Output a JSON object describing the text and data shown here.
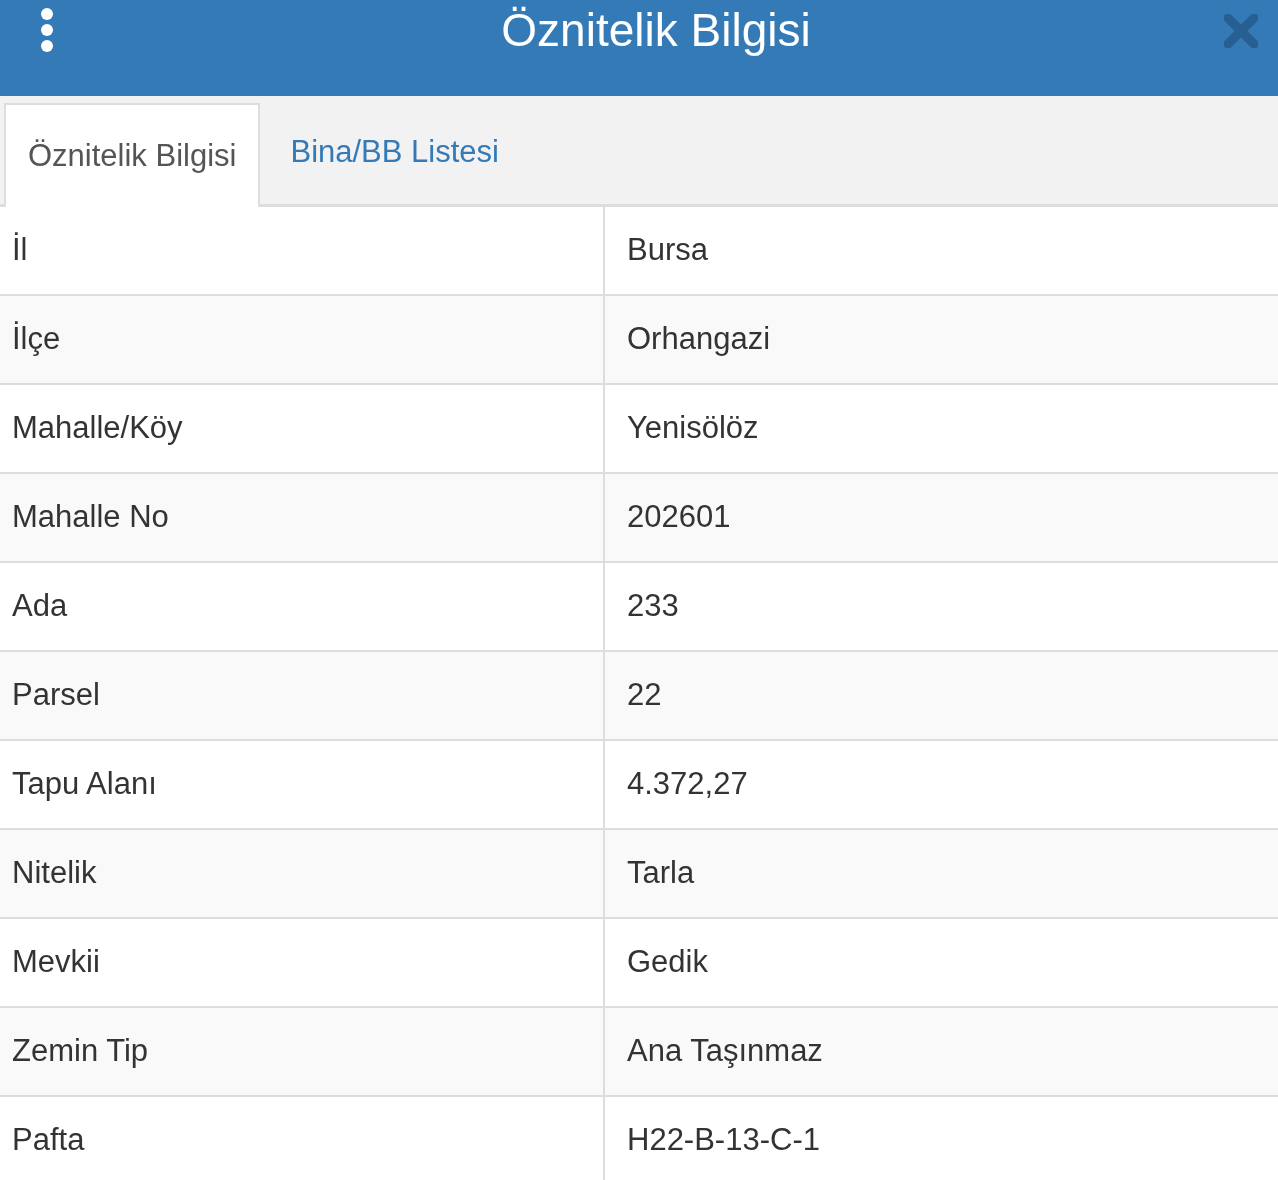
{
  "header": {
    "title": "Öznitelik Bilgisi"
  },
  "tabs": [
    {
      "label": "Öznitelik Bilgisi",
      "selected": true
    },
    {
      "label": "Bina/BB Listesi",
      "selected": false
    }
  ],
  "rows": [
    {
      "label": "İl",
      "value": "Bursa"
    },
    {
      "label": "İlçe",
      "value": "Orhangazi"
    },
    {
      "label": "Mahalle/Köy",
      "value": "Yenisölöz"
    },
    {
      "label": "Mahalle No",
      "value": "202601"
    },
    {
      "label": "Ada",
      "value": "233"
    },
    {
      "label": "Parsel",
      "value": "22"
    },
    {
      "label": "Tapu Alanı",
      "value": "4.372,27"
    },
    {
      "label": "Nitelik",
      "value": "Tarla"
    },
    {
      "label": "Mevkii",
      "value": "Gedik"
    },
    {
      "label": "Zemin Tip",
      "value": "Ana Taşınmaz"
    },
    {
      "label": "Pafta",
      "value": "H22-B-13-C-1"
    }
  ]
}
